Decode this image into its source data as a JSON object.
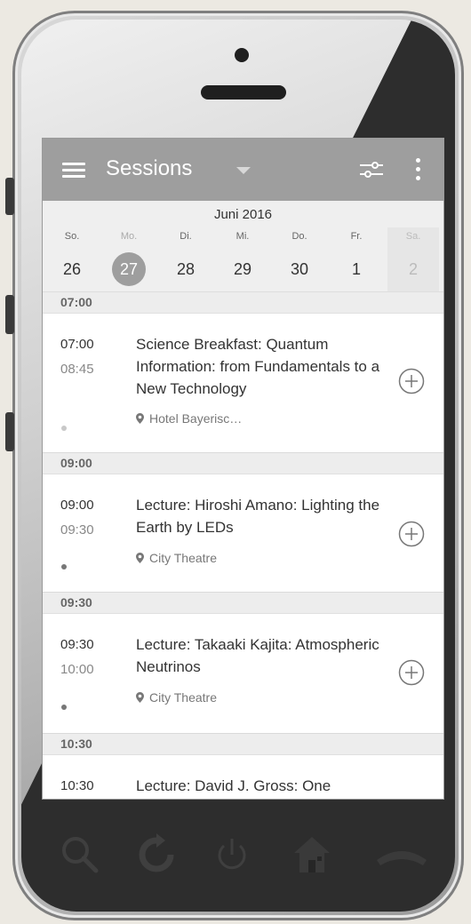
{
  "appbar": {
    "title": "Sessions"
  },
  "calendar": {
    "month": "Juni 2016",
    "days": [
      {
        "name": "So.",
        "num": "26"
      },
      {
        "name": "Mo.",
        "num": "27"
      },
      {
        "name": "Di.",
        "num": "28"
      },
      {
        "name": "Mi.",
        "num": "29"
      },
      {
        "name": "Do.",
        "num": "30"
      },
      {
        "name": "Fr.",
        "num": "1"
      },
      {
        "name": "Sa.",
        "num": "2"
      }
    ],
    "selected_index": 1
  },
  "sections": [
    {
      "header": "07:00",
      "sessions": [
        {
          "start": "07:00",
          "end": "08:45",
          "title": "Science Breakfast: Quantum Information: from Fundamentals to a New Technology",
          "location": "Hotel Bayerisc…"
        }
      ]
    },
    {
      "header": "09:00",
      "sessions": [
        {
          "start": "09:00",
          "end": "09:30",
          "title": "Lecture: Hiroshi Amano: Lighting the Earth by LEDs",
          "location": "City Theatre"
        }
      ]
    },
    {
      "header": "09:30",
      "sessions": [
        {
          "start": "09:30",
          "end": "10:00",
          "title": "Lecture: Takaaki Kajita: Atmospheric Neutrinos",
          "location": "City Theatre"
        }
      ]
    },
    {
      "header": "10:30",
      "sessions": [
        {
          "start": "10:30",
          "title": "Lecture: David J. Gross: One"
        }
      ]
    }
  ],
  "colors": {
    "appbar": "#9e9e9e",
    "selected_day": "#9e9e9e",
    "phone_dark": "#2d2d2d"
  }
}
